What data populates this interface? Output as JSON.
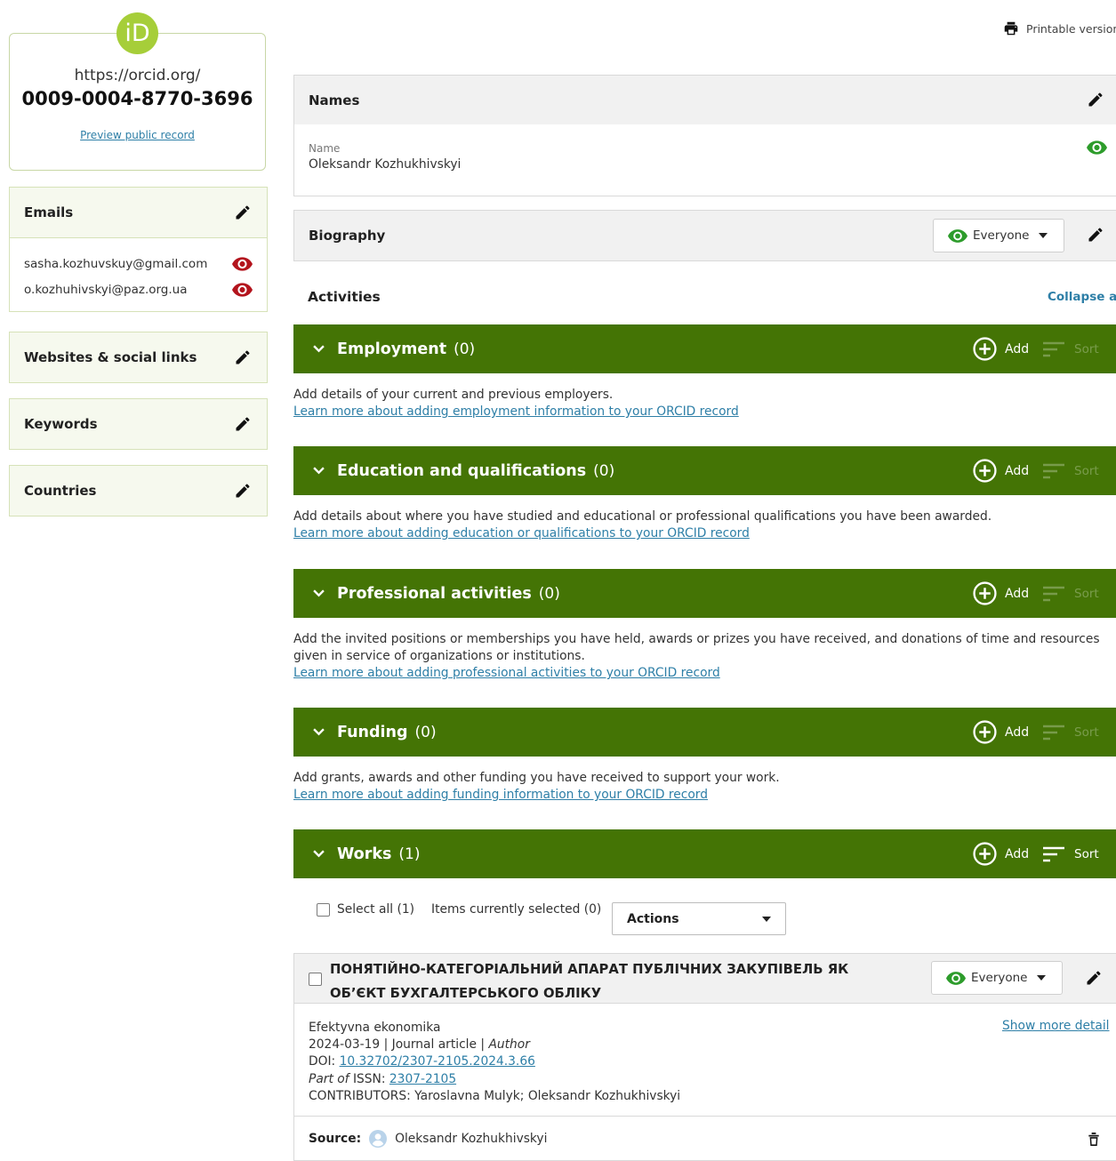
{
  "orcid": {
    "logo_text": "iD",
    "url": "https://orcid.org/",
    "id": "0009-0004-8770-3696",
    "preview_link": "Preview public record"
  },
  "sidebar": {
    "emails": {
      "title": "Emails",
      "items": [
        "sasha.kozhuvskuy@gmail.com",
        "o.kozhuhivskyi@paz.org.ua"
      ]
    },
    "websites": {
      "title": "Websites & social links"
    },
    "keywords": {
      "title": "Keywords"
    },
    "countries": {
      "title": "Countries"
    }
  },
  "header": {
    "printable": "Printable version"
  },
  "names": {
    "title": "Names",
    "field_label": "Name",
    "value": "Oleksandr Kozhukhivskyi"
  },
  "biography": {
    "title": "Biography",
    "visibility": "Everyone"
  },
  "activities": {
    "title": "Activities",
    "collapse_all": "Collapse all",
    "add_label": "Add",
    "sort_label": "Sort",
    "sections": [
      {
        "title": "Employment",
        "count": "(0)",
        "desc": "Add details of your current and previous employers.",
        "link": "Learn more about adding employment information to your ORCID record"
      },
      {
        "title": "Education and qualifications",
        "count": "(0)",
        "desc": "Add details about where you have studied and educational or professional qualifications you have been awarded.",
        "link": "Learn more about adding education or qualifications to your ORCID record"
      },
      {
        "title": "Professional activities",
        "count": "(0)",
        "desc": "Add the invited positions or memberships you have held, awards or prizes you have received, and donations of time and resources given in service of organizations or institutions.",
        "link": "Learn more about adding professional activities to your ORCID record"
      },
      {
        "title": "Funding",
        "count": "(0)",
        "desc": "Add grants, awards and other funding you have received to support your work.",
        "link": "Learn more about adding funding information to your ORCID record"
      },
      {
        "title": "Works",
        "count": "(1)"
      }
    ]
  },
  "works": {
    "select_all": "Select all (1)",
    "selected": "Items currently selected (0)",
    "actions": "Actions",
    "item": {
      "title": "ПОНЯТІЙНО-КАТЕГОРІАЛЬНИЙ АПАРАТ ПУБЛІЧНИХ ЗАКУПІВЕЛЬ ЯК ОБ’ЄКТ БУХГАЛТЕРСЬКОГО ОБЛІКУ",
      "visibility": "Everyone",
      "journal": "Efektyvna ekonomika",
      "date": "2024-03-19",
      "sep": "|",
      "type": "Journal article",
      "role": "Author",
      "doi_label": "DOI:",
      "doi": "10.32702/2307-2105.2024.3.66",
      "part_of": "Part of",
      "issn_label": "ISSN:",
      "issn": "2307-2105",
      "contributors": "CONTRIBUTORS: Yaroslavna Mulyk; Oleksandr Kozhukhivskyi",
      "show_more": "Show more detail",
      "source_label": "Source:",
      "source": "Oleksandr Kozhukhivskyi"
    }
  },
  "colors": {
    "orcid_green": "#a6ce39",
    "section_green": "#447405",
    "visible_green": "#2d9c2b",
    "private_red": "#b3141d",
    "link_blue": "#2e7fa7"
  }
}
